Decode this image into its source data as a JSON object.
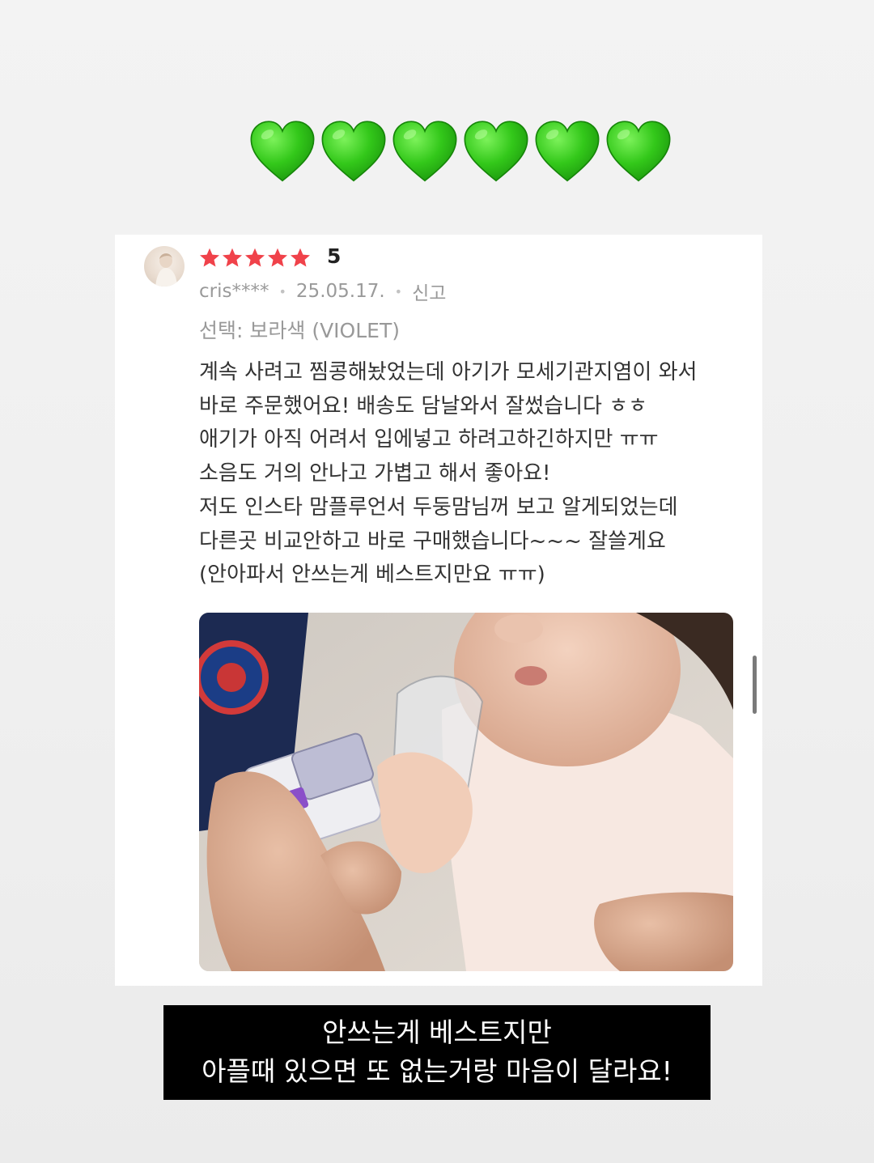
{
  "icons": {
    "heart_count": 6,
    "heart_color": "#3ad01e",
    "star_color": "#f0424a"
  },
  "review": {
    "rating": "5",
    "username": "cris****",
    "date": "25.05.17.",
    "report_label": "신고",
    "option": "선택: 보라색 (VIOLET)",
    "lines": [
      "계속 사려고 찜콩해놨었는데 아기가 모세기관지염이 와서",
      "바로 주문했어요! 배송도 담날와서 잘썼습니다 ㅎㅎ",
      "애기가 아직 어려서 입에넣고 하려고하긴하지만 ㅠㅠ",
      "소음도 거의 안나고 가볍고 해서 좋아요!",
      "저도 인스타 맘플루언서 두둥맘님꺼 보고 알게되었는데",
      "다른곳 비교안하고 바로 구매했습니다~~~ 잘쓸게요",
      "(안아파서 안쓰는게 베스트지만요 ㅠㅠ)"
    ]
  },
  "caption": {
    "line1": "안쓰는게 베스트지만",
    "line2": "아플때 있으면 또 없는거랑 마음이 달라요!"
  }
}
